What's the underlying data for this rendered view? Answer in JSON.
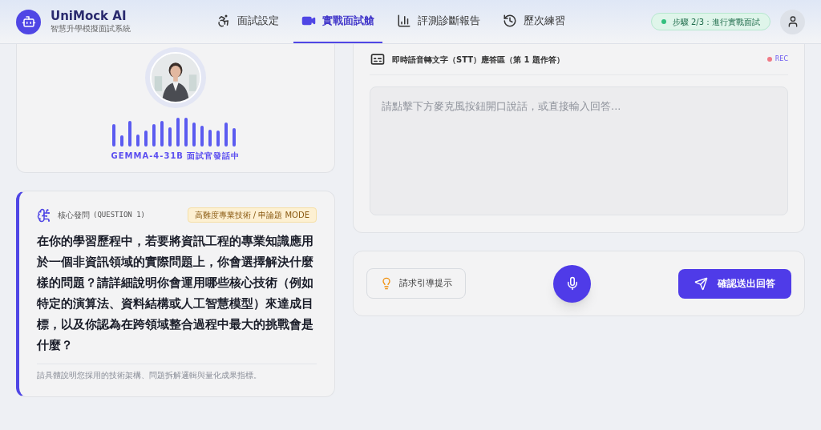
{
  "brand": {
    "name": "UniMock AI",
    "subtitle": "智慧升學模擬面試系統"
  },
  "nav": [
    {
      "label": "面試設定",
      "selected": false
    },
    {
      "label": "實戰面試艙",
      "selected": true
    },
    {
      "label": "評測診斷報告",
      "selected": false
    },
    {
      "label": "歷次練習",
      "selected": false
    }
  ],
  "step_badge": "步驟 2/3：進行實戰面試",
  "interviewer": {
    "status": "GEMMA-4-31B 面試官發話中"
  },
  "question": {
    "label": "核心發問",
    "tag": "(QUESTION 1)",
    "badge": "高難度專業技術 / 申論題 MODE",
    "text": "在你的學習歷程中，若要將資訊工程的專業知識應用於一個非資訊領域的實際問題上，你會選擇解決什麼樣的問題？請詳細說明你會運用哪些核心技術（例如特定的演算法、資料結構或人工智慧模型）來達成目標，以及你認為在跨領域整合過程中最大的挑戰會是什麼？",
    "hint": "請具體說明您採用的技術架構、問題拆解邏輯與量化成果指標。"
  },
  "answer": {
    "title": "即時語音轉文字（STT）應答區（第 1 題作答）",
    "rec": "REC",
    "recording": true,
    "placeholder": "請點擊下方麥克風按鈕開口說話，或直接輸入回答..."
  },
  "actions": {
    "hint_button": "請求引導提示",
    "submit_button": "確認送出回答"
  }
}
